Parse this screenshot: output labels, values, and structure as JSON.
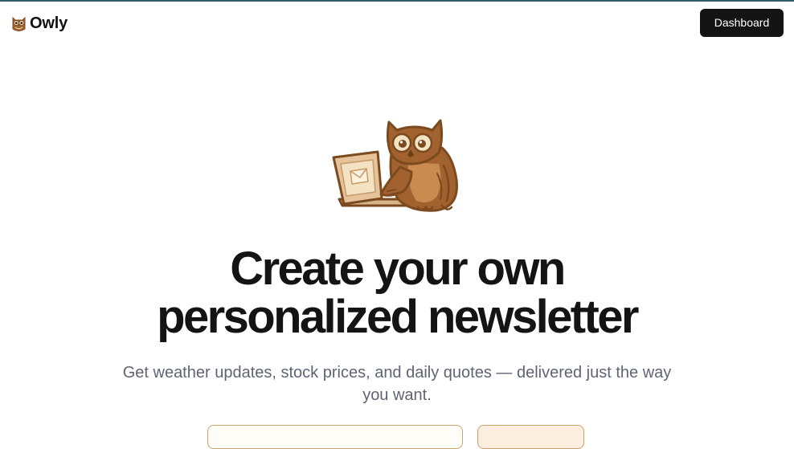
{
  "navbar": {
    "brand_name": "Owly",
    "dashboard_label": "Dashboard"
  },
  "hero": {
    "headline_line1": "Create your own",
    "headline_line2": "personalized newsletter",
    "subtitle": "Get weather updates, stock prices, and daily quotes — delivered just the way you want."
  },
  "icons": {
    "brand": "owl-icon",
    "hero": "owl-laptop-illustration"
  },
  "colors": {
    "top_line": "#2f5e6a",
    "dashboard_button_bg": "#141414",
    "headline": "#141414",
    "subtitle": "#5e6472",
    "owl_brown": "#a2622f",
    "owl_outline": "#7b4a1e",
    "owl_cream": "#f4e3c3",
    "accent_border": "#c9a26a"
  }
}
